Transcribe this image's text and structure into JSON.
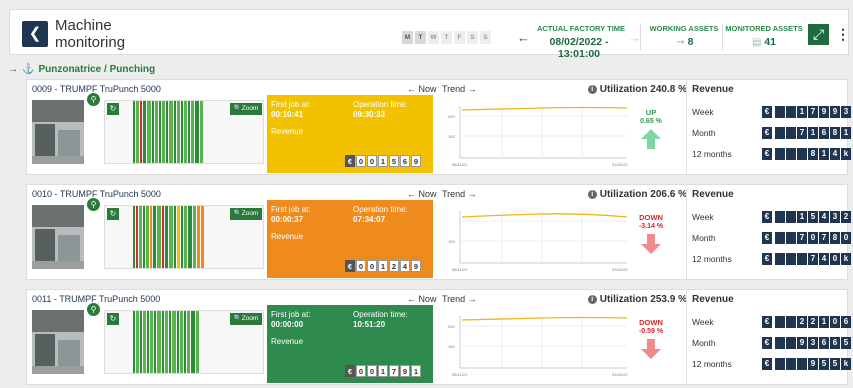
{
  "header": {
    "back_icon": "arrow-left-icon",
    "title_line1": "Machine",
    "title_line2": "monitoring",
    "days": [
      "M",
      "T",
      "W",
      "T",
      "F",
      "S",
      "S"
    ],
    "active_days": [
      0,
      1
    ],
    "actual_time_label": "ACTUAL FACTORY TIME",
    "actual_time_value": "08/02/2022 - 13:01:00",
    "working_label": "WORKING ASSETS",
    "working_value": "8",
    "monitored_label": "MONITORED ASSETS",
    "monitored_value": "41"
  },
  "breadcrumb": {
    "label": "Punzonatrice / Punching"
  },
  "machines": [
    {
      "title": "0009 - TRUMPF TruPunch 5000",
      "now_label": "← Now",
      "zoom_label": "🔍Zoom",
      "status_color": "#f2c200",
      "first_job_label": "First job at:",
      "first_job_value": "00:10:41",
      "operation_label": "Operation time:",
      "operation_value": "09:30:33",
      "revenue_label": "Revenue",
      "revenue_digits": [
        "0",
        "0",
        "1",
        "5",
        "6",
        "9"
      ],
      "trend_label": "Trend →",
      "utilization": "Utilization 240.8 %",
      "direction": "UP",
      "direction_pct": "0.65 %",
      "direction_color": "#2a9a4a",
      "trend_y_ticks": [
        "200",
        "100"
      ],
      "trend_x_start": "08/11/21",
      "trend_x_end": "31/01/22",
      "revenue_title": "Revenue",
      "revenue_rows": [
        {
          "label": "Week",
          "digits": [
            "",
            "",
            "1",
            "7",
            "9",
            "9",
            "3"
          ]
        },
        {
          "label": "Month",
          "digits": [
            "",
            "",
            "7",
            "1",
            "6",
            "8",
            "1"
          ]
        },
        {
          "label": "12 months",
          "digits": [
            "",
            "",
            "",
            "8",
            "1",
            "4",
            "k"
          ]
        }
      ]
    },
    {
      "title": "0010 - TRUMPF TruPunch 5000",
      "now_label": "← Now",
      "zoom_label": "🔍Zoom",
      "status_color": "#ee8b1c",
      "first_job_label": "First job at:",
      "first_job_value": "00:00:37",
      "operation_label": "Operation time:",
      "operation_value": "07:34:07",
      "revenue_label": "Revenue",
      "revenue_digits": [
        "0",
        "0",
        "1",
        "2",
        "4",
        "9"
      ],
      "trend_label": "Trend →",
      "utilization": "Utilization 206.6 %",
      "direction": "DOWN",
      "direction_pct": "-3.14 %",
      "direction_color": "#d9252b",
      "trend_y_ticks": [
        "100"
      ],
      "trend_x_start": "08/11/21",
      "trend_x_end": "31/01/22",
      "revenue_title": "Revenue",
      "revenue_rows": [
        {
          "label": "Week",
          "digits": [
            "",
            "",
            "1",
            "5",
            "4",
            "3",
            "2"
          ]
        },
        {
          "label": "Month",
          "digits": [
            "",
            "",
            "7",
            "0",
            "7",
            "8",
            "0"
          ]
        },
        {
          "label": "12 months",
          "digits": [
            "",
            "",
            "",
            "7",
            "4",
            "0",
            "k"
          ]
        }
      ]
    },
    {
      "title": "0011 - TRUMPF TruPunch 5000",
      "now_label": "← Now",
      "zoom_label": "🔍Zoom",
      "status_color": "#2f8a4e",
      "first_job_label": "First job at:",
      "first_job_value": "00:00:00",
      "operation_label": "Operation time:",
      "operation_value": "10:51:20",
      "revenue_label": "Revenue",
      "revenue_digits": [
        "0",
        "0",
        "1",
        "7",
        "9",
        "1"
      ],
      "trend_label": "Trend →",
      "utilization": "Utilization 253.9 %",
      "direction": "DOWN",
      "direction_pct": "-0.59 %",
      "direction_color": "#d9252b",
      "trend_y_ticks": [
        "200",
        "100"
      ],
      "trend_x_start": "08/11/21",
      "trend_x_end": "31/01/22",
      "revenue_title": "Revenue",
      "revenue_rows": [
        {
          "label": "Week",
          "digits": [
            "",
            "",
            "2",
            "2",
            "1",
            "0",
            "6"
          ]
        },
        {
          "label": "Month",
          "digits": [
            "",
            "",
            "9",
            "3",
            "6",
            "6",
            "5"
          ]
        },
        {
          "label": "12 months",
          "digits": [
            "",
            "",
            "",
            "9",
            "5",
            "5",
            "k"
          ]
        }
      ]
    }
  ]
}
